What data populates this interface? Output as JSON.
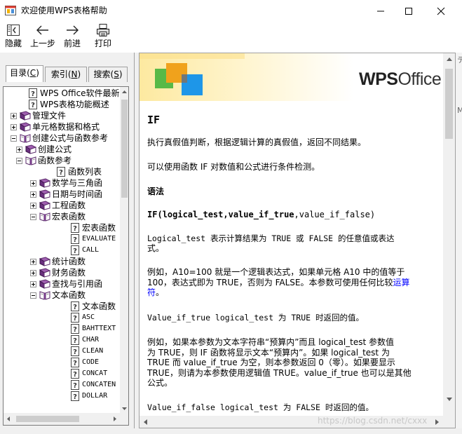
{
  "window": {
    "title": "欢迎使用WPS表格帮助"
  },
  "toolbar": {
    "hide_label": "隐藏",
    "back_label": "上一步",
    "forward_label": "前进",
    "print_label": "打印"
  },
  "tabs": {
    "toc_label": "目录(",
    "toc_key": "C",
    "toc_end": ")",
    "index_label": "索引(",
    "index_key": "N",
    "index_end": ")",
    "search_label": "搜索(",
    "search_key": "S",
    "search_end": ")"
  },
  "tree": [
    {
      "label": "WPS Office软件最新",
      "type": "page",
      "level": 1,
      "mono": false
    },
    {
      "label": "WPS表格功能概述",
      "type": "page",
      "level": 1,
      "mono": false
    },
    {
      "label": "管理文件",
      "type": "book",
      "level": 0,
      "expander": "plus"
    },
    {
      "label": "单元格数据和格式",
      "type": "book",
      "level": 0,
      "expander": "plus"
    },
    {
      "label": "创建公式与函数参考",
      "type": "book-open",
      "level": 0,
      "expander": "minus"
    },
    {
      "label": "创建公式",
      "type": "book",
      "level": 1,
      "expander": "plus"
    },
    {
      "label": "函数参考",
      "type": "book-open",
      "level": 1,
      "expander": "minus"
    },
    {
      "label": "函数列表",
      "type": "page",
      "level": 3
    },
    {
      "label": "数学与三角函",
      "type": "book",
      "level": 2,
      "expander": "plus"
    },
    {
      "label": "日期与时间函",
      "type": "book",
      "level": 2,
      "expander": "plus"
    },
    {
      "label": "工程函数",
      "type": "book",
      "level": 2,
      "expander": "plus"
    },
    {
      "label": "宏表函数",
      "type": "book-open",
      "level": 2,
      "expander": "minus"
    },
    {
      "label": "宏表函数",
      "type": "page",
      "level": 4
    },
    {
      "label": "EVALUATE",
      "type": "page",
      "level": 4,
      "mono": true
    },
    {
      "label": "CALL",
      "type": "page",
      "level": 4,
      "mono": true
    },
    {
      "label": "统计函数",
      "type": "book",
      "level": 2,
      "expander": "plus"
    },
    {
      "label": "财务函数",
      "type": "book",
      "level": 2,
      "expander": "plus"
    },
    {
      "label": "查找与引用函",
      "type": "book",
      "level": 2,
      "expander": "plus"
    },
    {
      "label": "文本函数",
      "type": "book-open",
      "level": 2,
      "expander": "minus"
    },
    {
      "label": "文本函数",
      "type": "page",
      "level": 4
    },
    {
      "label": "ASC",
      "type": "page",
      "level": 4,
      "mono": true
    },
    {
      "label": "BAHTTEXT",
      "type": "page",
      "level": 4,
      "mono": true
    },
    {
      "label": "CHAR",
      "type": "page",
      "level": 4,
      "mono": true
    },
    {
      "label": "CLEAN",
      "type": "page",
      "level": 4,
      "mono": true
    },
    {
      "label": "CODE",
      "type": "page",
      "level": 4,
      "mono": true
    },
    {
      "label": "CONCAT",
      "type": "page",
      "level": 4,
      "mono": true
    },
    {
      "label": "CONCATEN",
      "type": "page",
      "level": 4,
      "mono": true
    },
    {
      "label": "DOLLAR",
      "type": "page",
      "level": 4,
      "mono": true
    }
  ],
  "banner": {
    "logo_bold": "WPS",
    "logo_light": "Office"
  },
  "article": {
    "heading": "IF",
    "intro1": "执行真假值判断，根据逻辑计算的真假值，返回不同结果。",
    "intro2": "可以使用函数 IF 对数值和公式进行条件检测。",
    "syntax_heading": "语法",
    "syntax_fn": "IF(",
    "syntax_args_bold": "logical_test,value_if_true",
    "syntax_args_plain": ",value_if_false)",
    "p1_line1": "Logical_test   表示计算结果为 TRUE 或 FALSE 的任意值或表达",
    "p1_line2": "式。",
    "p2_line1": "例如，A10=100 就是一个逻辑表达式，如果单元格 A10 中的值等于",
    "p2_line2_a": "100，表达式即为 TRUE，否则为 FALSE。本参数可使用任何比较",
    "p2_link_a": "运算",
    "p2_link_b": "符",
    "p2_line3_end": "。",
    "p3": "Value_if_true   logical_test 为 TRUE 时返回的值。",
    "p4_line1": "例如，如果本参数为文本字符串“预算内”而且 logical_test 参数值",
    "p4_line2": "为 TRUE，则 IF 函数将显示文本“预算内”。如果 logical_test 为",
    "p4_line3": "TRUE 而 value_if_true 为空，则本参数返回 0（零）。如果要显示",
    "p4_line4": "TRUE，则请为本参数使用逻辑值 TRUE。value_if_true 也可以是其他",
    "p4_line5": "公式。",
    "p5": "Value_if_false   logical_test 为 FALSE 时返回的值。"
  },
  "right_edge": {
    "mark1": "テ",
    "mark2": "M"
  },
  "watermark": "https://blog.csdn.net/cxxx"
}
